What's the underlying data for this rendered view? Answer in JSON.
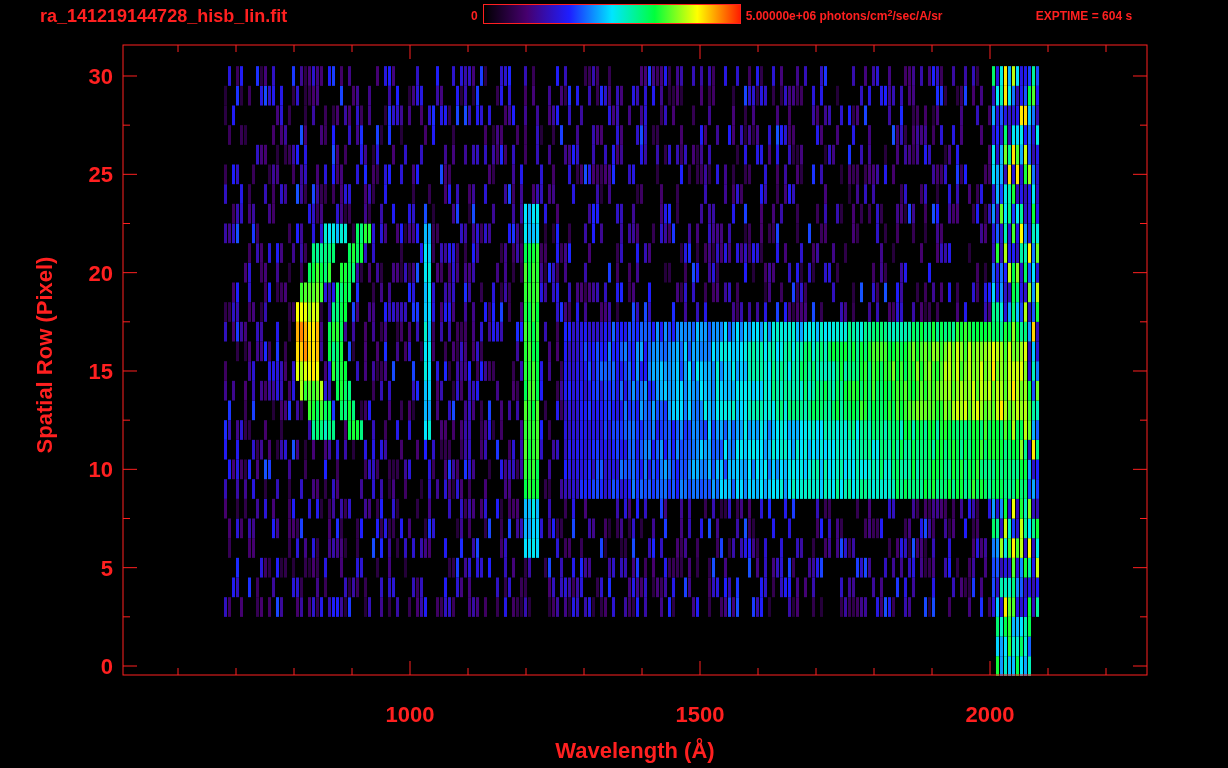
{
  "header": {
    "filename": "ra_141219144728_hisb_lin.fit",
    "colorbar_min": "0",
    "colorbar_max": "5.00000e+06 photons/cm$^{2}$/sec/A/sr",
    "exptime": "EXPTIME = 604 s"
  },
  "plot": {
    "ylabel": "Spatial Row (Pixel)",
    "xlabel": "Wavelength (Å)",
    "yticks": [
      "30",
      "25",
      "20",
      "15",
      "10",
      "5",
      "0"
    ],
    "xticks": [
      "1000",
      "1500",
      "2000"
    ]
  }
}
